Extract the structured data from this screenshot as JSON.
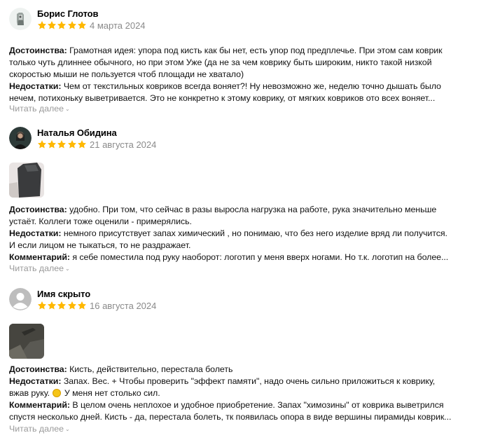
{
  "colors": {
    "star": "#ffb800",
    "muted_text": "#8a8a8a",
    "readmore_text": "#9a9a9a"
  },
  "reviews": [
    {
      "author": "Борис Глотов",
      "rating": 5,
      "date": "4 марта 2024",
      "avatar_icon": "user-avatar-figure",
      "lines": [
        {
          "label": "Достоинства:",
          "text": " Грамотная идея: упора под кисть как бы нет, есть упор под предплечье. При этом сам коврик"
        },
        {
          "label": "",
          "text": "только чуть длиннее обычного, но при этом Уже (да не за чем коврику быть широким, никто такой низкой"
        },
        {
          "label": "",
          "text": "скоростью мыши не пользуется чтоб площади не хватало)"
        },
        {
          "label": "Недостатки:",
          "text": " Чем от текстильных ковриков всегда воняет?! Ну невозможно же, неделю точно дышать было"
        },
        {
          "label": "",
          "text": "нечем, потихоньку выветривается. Это не конкретно к этому коврику, от мягких ковриков ото всех воняет..."
        }
      ],
      "read_more": "Читать далее"
    },
    {
      "author": "Наталья Обидина",
      "rating": 5,
      "date": "21 августа 2024",
      "avatar_icon": "user-avatar-photo",
      "photo_icon": "review-photo-thumbnail",
      "lines": [
        {
          "label": "Достоинства:",
          "text": " удобно. При том, что сейчас в разы выросла нагрузка на работе, рука значительно меньше"
        },
        {
          "label": "",
          "text": "устаёт. Коллеги тоже оценили - примерялись."
        },
        {
          "label": "Недостатки:",
          "text": " немного присутствует запах химический , но понимаю, что без него изделие вряд ли получится."
        },
        {
          "label": "",
          "text": "И если лицом не тыкаться, то не раздражает."
        },
        {
          "label": "Комментарий:",
          "text": " я себе поместила под руку наоборот: логотип у меня вверх ногами. Но т.к. логотип на более..."
        }
      ],
      "read_more": "Читать далее"
    },
    {
      "author": "Имя скрыто",
      "rating": 5,
      "date": "16 августа 2024",
      "avatar_icon": "anonymous-user-icon",
      "photo_icon": "review-photo-thumbnail",
      "lines": [
        {
          "label": "Достоинства:",
          "text": " Кисть, действительно, перестала болеть"
        },
        {
          "label": "Недостатки:",
          "text": " Запах. Вес. + Чтобы проверить \"эффект памяти\", надо очень сильно приложиться к коврику,"
        },
        {
          "label": "",
          "text": "вжав руку.",
          "emoji": "smiling-face-emoji",
          "after": " У меня нет столько сил."
        },
        {
          "label": "Комментарий:",
          "text": " В целом очень неплохое и удобное приобретение. Запах \"химозины\" от коврика выветрился"
        },
        {
          "label": "",
          "text": "спустя несколько дней. Кисть - да, перестала болеть, тк появилась опора в виде вершины пирамиды коврик..."
        }
      ],
      "read_more": "Читать далее"
    }
  ]
}
